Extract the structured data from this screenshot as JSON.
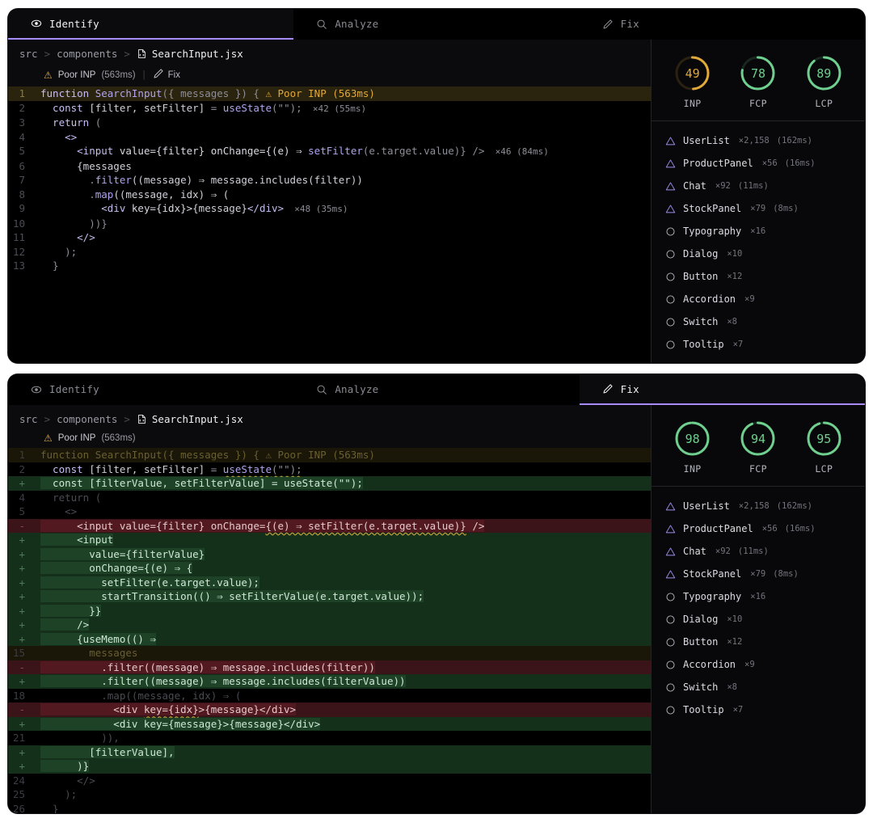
{
  "panels": [
    {
      "id": "identify",
      "tabs": [
        {
          "label": "Identify",
          "icon": "eye-icon",
          "active": true
        },
        {
          "label": "Analyze",
          "icon": "search-icon",
          "active": false
        },
        {
          "label": "Fix",
          "icon": "pencil-icon",
          "active": false
        }
      ],
      "breadcrumb": {
        "parts": [
          "src",
          "components"
        ],
        "file": "SearchInput.jsx",
        "file_icon": "jsx-file-icon",
        "separator": ">"
      },
      "finding": {
        "icon": "warning-triangle-icon",
        "label": "Poor INP",
        "time": "(563ms)",
        "divider": "|",
        "action": "Fix",
        "action_icon": "pencil-icon"
      },
      "scores": [
        {
          "label": "INP",
          "value": "49",
          "state": "warn",
          "pct": 49,
          "color": "#e0a93a"
        },
        {
          "label": "FCP",
          "value": "78",
          "state": "good",
          "pct": 78,
          "color": "#6fcf8e"
        },
        {
          "label": "LCP",
          "value": "89",
          "state": "good",
          "pct": 89,
          "color": "#6fcf8e"
        }
      ],
      "code": [
        {
          "num": "1",
          "hot": true,
          "segments": [
            {
              "t": "function ",
              "c": "k"
            },
            {
              "t": "SearchInput",
              "c": "fn"
            },
            {
              "t": "({ messages }) { ",
              "c": "p"
            },
            {
              "t": "⚠ Poor INP (563ms)",
              "c": "badge-inline"
            }
          ]
        },
        {
          "num": "2",
          "segments": [
            {
              "t": "  const ",
              "c": "k"
            },
            {
              "t": "[filter, setFilter]",
              "c": "pl"
            },
            {
              "t": " = ",
              "c": "p"
            },
            {
              "t": "useState",
              "c": "fn"
            },
            {
              "t": "(\"\");",
              "c": "p"
            },
            {
              "t": "  ×42 (55ms)",
              "c": "metric"
            }
          ]
        },
        {
          "num": "3",
          "segments": [
            {
              "t": "  return ",
              "c": "k"
            },
            {
              "t": "(",
              "c": "p"
            }
          ]
        },
        {
          "num": "4",
          "segments": [
            {
              "t": "    <>",
              "c": "tag"
            }
          ]
        },
        {
          "num": "5",
          "segments": [
            {
              "t": "      <input ",
              "c": "tag"
            },
            {
              "t": "value={filter} onChange={(e) ⇒ ",
              "c": "attr"
            },
            {
              "t": "setFilter",
              "c": "fn"
            },
            {
              "t": "(e.target.value)} />",
              "c": "p"
            },
            {
              "t": "  ×46 (84ms)",
              "c": "metric"
            }
          ]
        },
        {
          "num": "6",
          "segments": [
            {
              "t": "      {messages",
              "c": "pl"
            }
          ]
        },
        {
          "num": "7",
          "segments": [
            {
              "t": "        .",
              "c": "p"
            },
            {
              "t": "filter",
              "c": "fn"
            },
            {
              "t": "((message) ⇒ message.includes(filter))",
              "c": "pl"
            }
          ]
        },
        {
          "num": "8",
          "segments": [
            {
              "t": "        .",
              "c": "p"
            },
            {
              "t": "map",
              "c": "fn"
            },
            {
              "t": "((message, idx) ⇒ (",
              "c": "pl"
            }
          ]
        },
        {
          "num": "9",
          "segments": [
            {
              "t": "          <div ",
              "c": "tag"
            },
            {
              "t": "key={idx}>",
              "c": "attr"
            },
            {
              "t": "{message}",
              "c": "pl"
            },
            {
              "t": "</div>",
              "c": "tag"
            },
            {
              "t": "  ×48 (35ms)",
              "c": "metric"
            }
          ]
        },
        {
          "num": "10",
          "segments": [
            {
              "t": "        ))}",
              "c": "p"
            }
          ]
        },
        {
          "num": "11",
          "segments": [
            {
              "t": "      </>",
              "c": "tag"
            }
          ]
        },
        {
          "num": "12",
          "segments": [
            {
              "t": "    );",
              "c": "p"
            }
          ]
        },
        {
          "num": "13",
          "segments": [
            {
              "t": "  }",
              "c": "p"
            }
          ]
        }
      ],
      "components": [
        {
          "icon": "warning-triangle-icon",
          "name": "UserList",
          "count": "×2,158",
          "time": "(162ms)"
        },
        {
          "icon": "warning-triangle-icon",
          "name": "ProductPanel",
          "count": "×56",
          "time": "(16ms)"
        },
        {
          "icon": "warning-triangle-icon",
          "name": "Chat",
          "count": "×92",
          "time": "(11ms)"
        },
        {
          "icon": "warning-triangle-icon",
          "name": "StockPanel",
          "count": "×79",
          "time": "(8ms)"
        },
        {
          "icon": "circle-icon",
          "name": "Typography",
          "count": "×16",
          "time": ""
        },
        {
          "icon": "circle-icon",
          "name": "Dialog",
          "count": "×10",
          "time": ""
        },
        {
          "icon": "circle-icon",
          "name": "Button",
          "count": "×12",
          "time": ""
        },
        {
          "icon": "circle-icon",
          "name": "Accordion",
          "count": "×9",
          "time": ""
        },
        {
          "icon": "circle-icon",
          "name": "Switch",
          "count": "×8",
          "time": ""
        },
        {
          "icon": "circle-icon",
          "name": "Tooltip",
          "count": "×7",
          "time": ""
        }
      ]
    },
    {
      "id": "fix",
      "tabs": [
        {
          "label": "Identify",
          "icon": "eye-icon",
          "active": false
        },
        {
          "label": "Analyze",
          "icon": "search-icon",
          "active": false
        },
        {
          "label": "Fix",
          "icon": "pencil-icon",
          "active": true
        }
      ],
      "breadcrumb": {
        "parts": [
          "src",
          "components"
        ],
        "file": "SearchInput.jsx",
        "file_icon": "jsx-file-icon",
        "separator": ">"
      },
      "finding": {
        "icon": "warning-triangle-icon",
        "label": "Poor INP",
        "time": "(563ms)",
        "divider": "",
        "action": "",
        "action_icon": ""
      },
      "scores": [
        {
          "label": "INP",
          "value": "98",
          "state": "good",
          "pct": 98,
          "color": "#6fcf8e"
        },
        {
          "label": "FCP",
          "value": "94",
          "state": "good",
          "pct": 94,
          "color": "#6fcf8e"
        },
        {
          "label": "LCP",
          "value": "95",
          "state": "good",
          "pct": 95,
          "color": "#6fcf8e"
        }
      ],
      "diff": [
        {
          "num": "1",
          "kind": "ctx-hot",
          "segments": [
            {
              "t": "function SearchInput({ messages }) { ⚠ Poor INP (563ms)"
            }
          ]
        },
        {
          "num": "2",
          "kind": "ctx",
          "bright": true,
          "segments": [
            {
              "t": "  const ",
              "c": "k"
            },
            {
              "t": "[filter, setFilter]",
              "c": "pl"
            },
            {
              "t": " = ",
              "c": "p"
            },
            {
              "t": "useState",
              "c": "fn squig"
            },
            {
              "t": "(\"\");",
              "c": "p squig"
            }
          ]
        },
        {
          "num": "+",
          "kind": "add",
          "segments": [
            {
              "t": "  const [filterValue, setFilterValue] = useState(\"\");",
              "seg": true
            }
          ]
        },
        {
          "num": "4",
          "kind": "ctx",
          "segments": [
            {
              "t": "  return ("
            }
          ]
        },
        {
          "num": "5",
          "kind": "ctx",
          "segments": [
            {
              "t": "    <>"
            }
          ]
        },
        {
          "num": "-",
          "kind": "del",
          "segments": [
            {
              "t": "      <input value={filter} onChange=",
              "seg": true
            },
            {
              "t": "{(e) ⇒ setFilter(e.target.value)}",
              "seg": true,
              "c": "squig"
            },
            {
              "t": " />",
              "seg": true
            }
          ]
        },
        {
          "num": "+",
          "kind": "add",
          "segments": [
            {
              "t": "      <input",
              "seg": true
            }
          ]
        },
        {
          "num": "+",
          "kind": "add",
          "segments": [
            {
              "t": "        value={filterValue}",
              "seg": true
            }
          ]
        },
        {
          "num": "+",
          "kind": "add",
          "segments": [
            {
              "t": "        onChange={(e) ⇒ {",
              "seg": true
            }
          ]
        },
        {
          "num": "+",
          "kind": "add",
          "segments": [
            {
              "t": "          setFilter(e.target.value);",
              "seg": true
            }
          ]
        },
        {
          "num": "+",
          "kind": "add",
          "segments": [
            {
              "t": "          startTransition(() ⇒ setFilterValue(e.target.value));",
              "seg": true
            }
          ]
        },
        {
          "num": "+",
          "kind": "add",
          "segments": [
            {
              "t": "        }}",
              "seg": true
            }
          ]
        },
        {
          "num": "+",
          "kind": "add",
          "segments": [
            {
              "t": "      />",
              "seg": true
            }
          ]
        },
        {
          "num": "+",
          "kind": "add",
          "segments": [
            {
              "t": "      {useMemo(() ⇒",
              "seg": true
            }
          ]
        },
        {
          "num": "15",
          "kind": "ctx-hot",
          "segments": [
            {
              "t": "        messages"
            }
          ]
        },
        {
          "num": "-",
          "kind": "del",
          "segments": [
            {
              "t": "          .filter((message) ⇒ message.includes(filter))",
              "seg": true
            }
          ]
        },
        {
          "num": "+",
          "kind": "add",
          "segments": [
            {
              "t": "          .filter((message) ⇒ message.includes(filterValue))",
              "seg": true
            }
          ]
        },
        {
          "num": "18",
          "kind": "ctx",
          "segments": [
            {
              "t": "          .map((message, idx) ⇒ ("
            }
          ]
        },
        {
          "num": "-",
          "kind": "del",
          "segments": [
            {
              "t": "            <div ",
              "seg": true
            },
            {
              "t": "key={idx}",
              "seg": true,
              "c": "squig"
            },
            {
              "t": ">{message}</div>",
              "seg": true
            }
          ]
        },
        {
          "num": "+",
          "kind": "add",
          "segments": [
            {
              "t": "            <div key={message}>{message}</div>",
              "seg": true
            }
          ]
        },
        {
          "num": "21",
          "kind": "ctx",
          "segments": [
            {
              "t": "          )),",
              "c": ""
            }
          ]
        },
        {
          "num": "+",
          "kind": "add",
          "segments": [
            {
              "t": "        [filterValue],",
              "seg": true
            }
          ]
        },
        {
          "num": "+",
          "kind": "add",
          "segments": [
            {
              "t": "      )}",
              "seg": true
            }
          ]
        },
        {
          "num": "24",
          "kind": "ctx",
          "segments": [
            {
              "t": "      </>"
            }
          ]
        },
        {
          "num": "25",
          "kind": "ctx",
          "segments": [
            {
              "t": "    );"
            }
          ]
        },
        {
          "num": "26",
          "kind": "ctx",
          "segments": [
            {
              "t": "  }"
            }
          ]
        }
      ],
      "components": [
        {
          "icon": "warning-triangle-icon",
          "name": "UserList",
          "count": "×2,158",
          "time": "(162ms)"
        },
        {
          "icon": "warning-triangle-icon",
          "name": "ProductPanel",
          "count": "×56",
          "time": "(16ms)"
        },
        {
          "icon": "warning-triangle-icon",
          "name": "Chat",
          "count": "×92",
          "time": "(11ms)"
        },
        {
          "icon": "warning-triangle-icon",
          "name": "StockPanel",
          "count": "×79",
          "time": "(8ms)"
        },
        {
          "icon": "circle-icon",
          "name": "Typography",
          "count": "×16",
          "time": ""
        },
        {
          "icon": "circle-icon",
          "name": "Dialog",
          "count": "×10",
          "time": ""
        },
        {
          "icon": "circle-icon",
          "name": "Button",
          "count": "×12",
          "time": ""
        },
        {
          "icon": "circle-icon",
          "name": "Accordion",
          "count": "×9",
          "time": ""
        },
        {
          "icon": "circle-icon",
          "name": "Switch",
          "count": "×8",
          "time": ""
        },
        {
          "icon": "circle-icon",
          "name": "Tooltip",
          "count": "×7",
          "time": ""
        }
      ]
    }
  ]
}
